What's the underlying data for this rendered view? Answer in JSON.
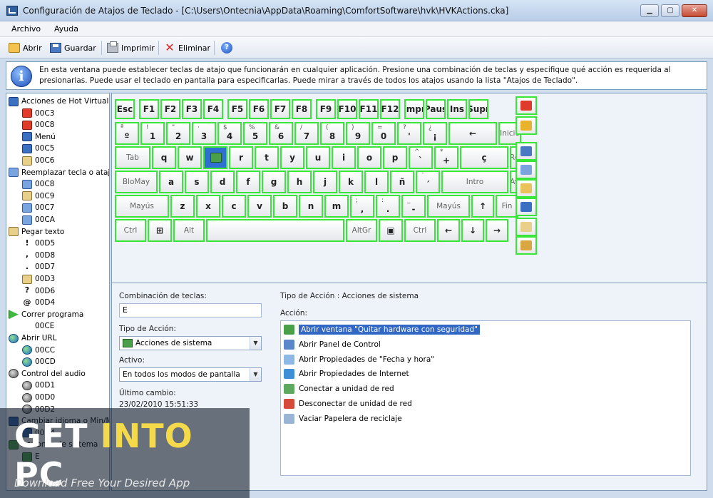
{
  "window": {
    "title": "Configuración de Atajos de Teclado - [C:\\Users\\Ontecnia\\AppData\\Roaming\\ComfortSoftware\\hvk\\HVKActions.cka]",
    "minimize": "▁",
    "maximize": "▢",
    "close": "✕"
  },
  "menu": {
    "archivo": "Archivo",
    "ayuda": "Ayuda"
  },
  "toolbar": {
    "open": "Abrir",
    "save": "Guardar",
    "print": "Imprimir",
    "delete": "Eliminar",
    "help": "?"
  },
  "info": {
    "icon": "i",
    "text": "En esta ventana puede establecer teclas de atajo que funcionarán en cualquier aplicación. Presione una combinación de teclas y especifique qué acción es requerida al presionarlas. Puede usar el teclado en pantalla para especificarlas. Puede mirar a través de todos los atajos usando la lista \"Atajos de Teclado\"."
  },
  "tree": [
    {
      "label": "Acciones de Hot Virtual",
      "level": 0,
      "icon": "monitor-icon"
    },
    {
      "label": "00C3",
      "level": 1,
      "icon": "x-icon"
    },
    {
      "label": "00C8",
      "level": 1,
      "icon": "x-icon"
    },
    {
      "label": "Menú",
      "level": 1,
      "icon": "monitor-icon"
    },
    {
      "label": "00C5",
      "level": 1,
      "icon": "monitor-icon"
    },
    {
      "label": "00C6",
      "level": 1,
      "icon": "paste-icon"
    },
    {
      "label": "Reemplazar tecla o atajo",
      "level": 0,
      "icon": "swap-icon"
    },
    {
      "label": "00C8",
      "level": 1,
      "icon": "swap-icon"
    },
    {
      "label": "00C9",
      "level": 1,
      "icon": "paste-icon"
    },
    {
      "label": "00C7",
      "level": 1,
      "icon": "swap-icon"
    },
    {
      "label": "00CA",
      "level": 1,
      "icon": "swap-icon"
    },
    {
      "label": "Pegar texto",
      "level": 0,
      "icon": "paste-icon"
    },
    {
      "label": "00D5",
      "level": 1,
      "icon": "dot-icon",
      "glyph": "!"
    },
    {
      "label": "00D8",
      "level": 1,
      "icon": "dot-icon",
      "glyph": ","
    },
    {
      "label": "00D7",
      "level": 1,
      "icon": "dot-icon",
      "glyph": "."
    },
    {
      "label": "00D3",
      "level": 1,
      "icon": "paste-icon"
    },
    {
      "label": "00D6",
      "level": 1,
      "icon": "dot-icon",
      "glyph": "?"
    },
    {
      "label": "00D4",
      "level": 1,
      "icon": "dot-icon",
      "glyph": "@"
    },
    {
      "label": "Correr programa",
      "level": 0,
      "icon": "play-icon"
    },
    {
      "label": "00CE",
      "level": 1,
      "icon": "none"
    },
    {
      "label": "Abrir URL",
      "level": 0,
      "icon": "globe-icon"
    },
    {
      "label": "00CC",
      "level": 1,
      "icon": "globe-icon"
    },
    {
      "label": "00CD",
      "level": 1,
      "icon": "globe-icon"
    },
    {
      "label": "Control del audio",
      "level": 0,
      "icon": "audio-icon"
    },
    {
      "label": "00D1",
      "level": 1,
      "icon": "audio-icon"
    },
    {
      "label": "00D0",
      "level": 1,
      "icon": "audio-icon"
    },
    {
      "label": "00D2",
      "level": 1,
      "icon": "audio-icon"
    },
    {
      "label": "Cambiar idioma o Min/Ma",
      "level": 0,
      "icon": "lang-icon"
    },
    {
      "label": "00D4",
      "level": 1,
      "icon": "lang-icon"
    },
    {
      "label": "Acciones de sistema",
      "level": 0,
      "icon": "system-icon"
    },
    {
      "label": "E",
      "level": 1,
      "icon": "system-icon"
    }
  ],
  "keyboard": {
    "rows": [
      [
        {
          "main": "Esc",
          "w": 30
        },
        {
          "gap": 4
        },
        {
          "main": "F1",
          "w": 30
        },
        {
          "main": "F2",
          "w": 30
        },
        {
          "main": "F3",
          "w": 30
        },
        {
          "main": "F4",
          "w": 30
        },
        {
          "gap": 4
        },
        {
          "main": "F5",
          "w": 30
        },
        {
          "main": "F6",
          "w": 30
        },
        {
          "main": "F7",
          "w": 30
        },
        {
          "main": "F8",
          "w": 30
        },
        {
          "gap": 4
        },
        {
          "main": "F9",
          "w": 30
        },
        {
          "main": "F10",
          "w": 30
        },
        {
          "main": "F11",
          "w": 30
        },
        {
          "main": "F12",
          "w": 30
        },
        {
          "gap": 4
        },
        {
          "main": "Impr",
          "w": 30
        },
        {
          "main": "Paus",
          "w": 30
        },
        {
          "main": "Ins",
          "w": 30
        },
        {
          "main": "Supr",
          "w": 30
        }
      ],
      [
        {
          "sub": "ª",
          "main": "º",
          "w": 36
        },
        {
          "sub": "!",
          "main": "1",
          "w": 36
        },
        {
          "sub": "\"",
          "main": "2",
          "w": 36
        },
        {
          "sub": "·",
          "main": "3",
          "w": 36
        },
        {
          "sub": "$",
          "main": "4",
          "w": 36
        },
        {
          "sub": "%",
          "main": "5",
          "w": 36
        },
        {
          "sub": "&",
          "main": "6",
          "w": 36
        },
        {
          "sub": "/",
          "main": "7",
          "w": 36
        },
        {
          "sub": "(",
          "main": "8",
          "w": 36
        },
        {
          "sub": ")",
          "main": "9",
          "w": 36
        },
        {
          "sub": "=",
          "main": "0",
          "w": 36
        },
        {
          "sub": "?",
          "main": "'",
          "w": 36
        },
        {
          "sub": "¿",
          "main": "¡",
          "w": 36
        },
        {
          "main": "←",
          "w": 70,
          "single": true
        },
        {
          "main": "Inicio",
          "w": 34,
          "gray": true
        }
      ],
      [
        {
          "main": "Tab",
          "w": 52,
          "gray": true
        },
        {
          "main": "q",
          "w": 36
        },
        {
          "main": "w",
          "w": 36
        },
        {
          "main": "e",
          "w": 36,
          "selected": true
        },
        {
          "main": "r",
          "w": 36
        },
        {
          "main": "t",
          "w": 36
        },
        {
          "main": "y",
          "w": 36
        },
        {
          "main": "u",
          "w": 36
        },
        {
          "main": "i",
          "w": 36
        },
        {
          "main": "o",
          "w": 36
        },
        {
          "main": "p",
          "w": 36
        },
        {
          "sub": "^",
          "main": "`",
          "w": 36
        },
        {
          "sub": "*",
          "main": "+",
          "w": 36
        },
        {
          "main": "ç",
          "w": 70,
          "single": true
        },
        {
          "main": "RePág",
          "w": 34,
          "gray": true
        }
      ],
      [
        {
          "main": "BloMay",
          "w": 62,
          "gray": true
        },
        {
          "main": "a",
          "w": 36
        },
        {
          "main": "s",
          "w": 36
        },
        {
          "main": "d",
          "w": 36
        },
        {
          "main": "f",
          "w": 36
        },
        {
          "main": "g",
          "w": 36
        },
        {
          "main": "h",
          "w": 36
        },
        {
          "main": "j",
          "w": 36
        },
        {
          "main": "k",
          "w": 36
        },
        {
          "main": "l",
          "w": 36
        },
        {
          "main": "ñ",
          "w": 36
        },
        {
          "sub": "¨",
          "main": "´",
          "w": 36
        },
        {
          "main": "Intro",
          "w": 96,
          "gray": true
        },
        {
          "main": "AvPág",
          "w": 34,
          "gray": true
        }
      ],
      [
        {
          "main": "Mayús",
          "w": 78,
          "gray": true
        },
        {
          "main": "z",
          "w": 36
        },
        {
          "main": "x",
          "w": 36
        },
        {
          "main": "c",
          "w": 36
        },
        {
          "main": "v",
          "w": 36
        },
        {
          "main": "b",
          "w": 36
        },
        {
          "main": "n",
          "w": 36
        },
        {
          "main": "m",
          "w": 36
        },
        {
          "sub": ";",
          "main": ",",
          "w": 36
        },
        {
          "sub": ":",
          "main": ".",
          "w": 36
        },
        {
          "sub": "_",
          "main": "-",
          "w": 36
        },
        {
          "main": "Mayús",
          "w": 62,
          "gray": true
        },
        {
          "main": "↑",
          "w": 34,
          "single": true
        },
        {
          "main": "Fin",
          "w": 34,
          "gray": true
        }
      ],
      [
        {
          "main": "Ctrl",
          "w": 46,
          "gray": true
        },
        {
          "main": "⊞",
          "w": 36,
          "single": true
        },
        {
          "main": "Alt",
          "w": 46,
          "gray": true
        },
        {
          "main": "",
          "w": 196
        },
        {
          "main": "AltGr",
          "w": 46,
          "gray": true
        },
        {
          "main": "▣",
          "w": 36,
          "single": true
        },
        {
          "main": "Ctrl",
          "w": 46,
          "gray": true
        },
        {
          "main": "←",
          "w": 34,
          "single": true
        },
        {
          "main": "↓",
          "w": 34,
          "single": true
        },
        {
          "main": "→",
          "w": 34,
          "single": true
        }
      ]
    ]
  },
  "side_keys": [
    {
      "name": "delete-icon",
      "color": "#e03a2b"
    },
    {
      "name": "flag-es-icon",
      "color": "#e8b22c"
    },
    {
      "name": "cut-icon",
      "color": "#4a78c2"
    },
    {
      "name": "copy-icon",
      "color": "#7aa4e0"
    },
    {
      "name": "paste-icon",
      "color": "#e9c35a"
    },
    {
      "name": "undo-icon",
      "color": "#3b6fc2"
    },
    {
      "name": "edit-icon",
      "color": "#e9d08a"
    },
    {
      "name": "properties-icon",
      "color": "#d9a640"
    }
  ],
  "form": {
    "combo_label": "Combinación de teclas:",
    "combo_value": "E",
    "type_label": "Tipo de Acción:",
    "type_value": "Acciones de sistema",
    "active_label": "Activo:",
    "active_value": "En todos los modos de pantalla",
    "lastchange_label": "Último cambio:",
    "lastchange_value": "23/02/2010 15:51:33",
    "action_type_title": "Tipo de Acción : Acciones de sistema",
    "action_label": "Acción:"
  },
  "actions": [
    {
      "label": "Abrir ventana \"Quitar hardware con seguridad\"",
      "color": "#49a049",
      "selected": true
    },
    {
      "label": "Abrir Panel de Control",
      "color": "#5b86c9"
    },
    {
      "label": "Abrir Propiedades de \"Fecha y hora\"",
      "color": "#8fb8e6"
    },
    {
      "label": "Abrir Propiedades de Internet",
      "color": "#3f8fd6"
    },
    {
      "label": "Conectar a unidad de red",
      "color": "#5fa85f"
    },
    {
      "label": "Desconectar de unidad de red",
      "color": "#d64a3a"
    },
    {
      "label": "Vaciar Papelera de reciclaje",
      "color": "#9ab4d6"
    }
  ],
  "watermark": {
    "get": "GET ",
    "into": "INTO",
    "pc": " PC",
    "tagline": "Download Free Your Desired App"
  }
}
